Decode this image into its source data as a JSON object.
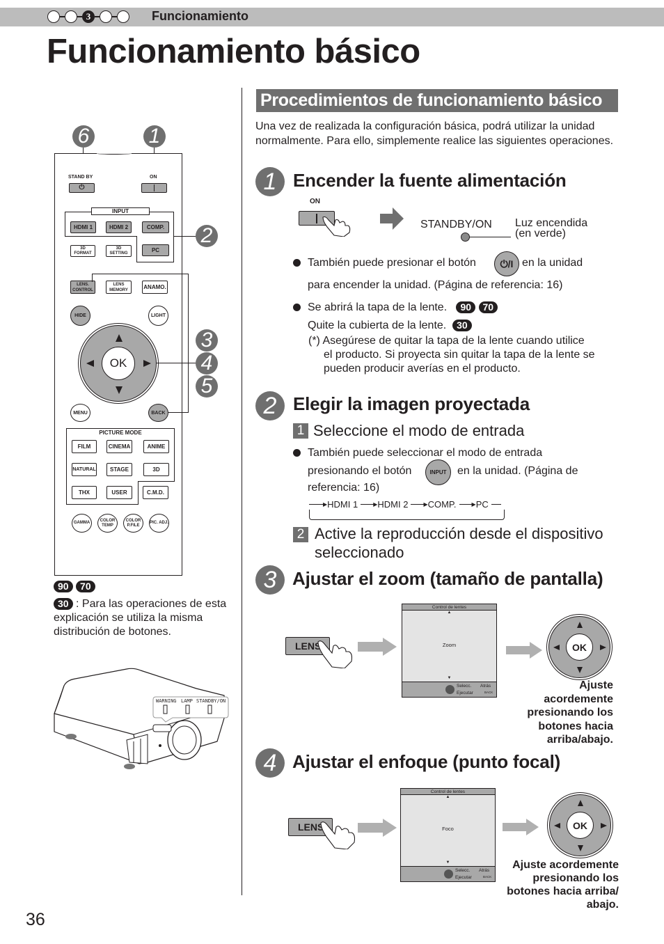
{
  "header": {
    "chapter_steps": [
      "",
      "",
      "3",
      "",
      ""
    ],
    "active_step": 2,
    "section_label": "Funcionamiento",
    "page_title": "Funcionamiento básico"
  },
  "left": {
    "remote": {
      "callouts": {
        "standby": "6",
        "on": "1",
        "input": "2",
        "ok_a": "3",
        "ok_b": "4",
        "ok_c": "5"
      },
      "standby_label": "STAND BY",
      "on_label": "ON",
      "input_label": "INPUT",
      "keys": {
        "hdmi1": "HDMI 1",
        "hdmi2": "HDMI 2",
        "comp": "COMP.",
        "format3d": "3D FORMAT",
        "setting3d": "3D SETTING",
        "pc": "PC",
        "lens_control": "LENS. CONTROL",
        "lens_memory": "LENS MEMORY",
        "anamo": "ANAMO.",
        "hide": "HIDE",
        "light": "LIGHT",
        "ok": "OK",
        "menu": "MENU",
        "back": "BACK"
      },
      "picture_mode_label": "PICTURE MODE",
      "picture_modes": [
        "FILM",
        "CINEMA",
        "ANIME",
        "NATURAL",
        "STAGE",
        "3D",
        "THX",
        "USER",
        "C.M.D."
      ],
      "round_keys": [
        "GAMMA",
        "COLOR TEMP",
        "COLOR P.FILE",
        "PIC. ADJ."
      ]
    },
    "models_line1": [
      "90",
      "70"
    ],
    "models_line2": [
      "30"
    ],
    "note_text": ": Para las operaciones de esta explicación se utiliza la misma distribución de botones.",
    "projector_indicators": [
      "WARNING",
      "LAMP",
      "STANDBY/ON"
    ]
  },
  "right": {
    "banner": "Procedimientos de funcionamiento básico",
    "intro": "Una vez de realizada la configuración básica, podrá utilizar la unidad normalmente. Para ello, simplemente realice las siguientes operaciones.",
    "step1": {
      "num": "1",
      "title": "Encender la fuente alimentación",
      "on_label": "ON",
      "indicator_label": "STANDBY/ON",
      "indicator_status_1": "Luz encendida",
      "indicator_status_2": "(en verde)",
      "bullet1_a": "También puede presionar el botón",
      "unit_button_label": "⏻/I",
      "bullet1_b": "en la unidad",
      "bullet1_c": "para encender la unidad. (Página de referencia: 16)",
      "bullet2_a": "Se abrirá la tapa de la lente.",
      "bullet2_models": [
        "90",
        "70"
      ],
      "bullet2_b": "Quite la cubierta de la lente.",
      "bullet2_b_models": [
        "30"
      ],
      "note_1": "(*) Asegúrese de quitar la tapa de la lente cuando utilice",
      "note_2": "el producto. Si proyecta sin quitar la tapa de la lente se",
      "note_3": "pueden producir averías en el producto."
    },
    "step2": {
      "num": "2",
      "title": "Elegir la imagen proyectada",
      "sub1_num": "1",
      "sub1_title": "Seleccione el modo de entrada",
      "bullet_a": "También puede seleccionar el modo de entrada",
      "bullet_b": "presionando el botón",
      "input_button_label": "INPUT",
      "bullet_c": "en la unidad. (Página de",
      "bullet_d": "referencia: 16)",
      "cycle": [
        "HDMI 1",
        "HDMI 2",
        "COMP.",
        "PC"
      ],
      "sub2_num": "2",
      "sub2_title_1": "Active la reproducción desde el dispositivo",
      "sub2_title_2": "seleccionado"
    },
    "step3": {
      "num": "3",
      "title": "Ajustar el zoom (tamaño de pantalla)",
      "lens_button": "LENS",
      "osd_header": "Control de lentes",
      "osd_item": "Zoom",
      "osd_select": "Selecc.",
      "osd_execute": "Ejecutar",
      "osd_back": "Atrás",
      "osd_back_key": "BACK",
      "ok_label": "OK",
      "caption": [
        "Ajuste",
        "acordemente",
        "presionando los",
        "botones hacia",
        "arriba/abajo."
      ]
    },
    "step4": {
      "num": "4",
      "title": "Ajustar el enfoque (punto focal)",
      "lens_button": "LENS",
      "osd_header": "Control de lentes",
      "osd_item": "Foco",
      "osd_select": "Selecc.",
      "osd_execute": "Ejecutar",
      "osd_back": "Atrás",
      "osd_back_key": "BACK",
      "ok_label": "OK",
      "caption": [
        "Ajuste acordemente",
        "presionando los",
        "botones hacia arriba/",
        "abajo."
      ]
    }
  },
  "footer": {
    "page_number": "36"
  }
}
